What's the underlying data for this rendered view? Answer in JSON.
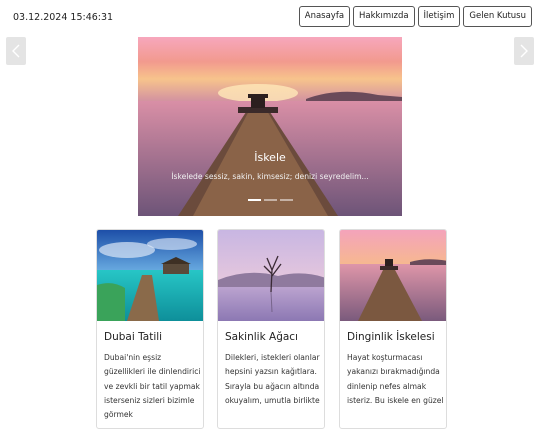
{
  "header": {
    "datetime": "03.12.2024 15:46:31"
  },
  "nav": {
    "items": [
      "Anasayfa",
      "Hakkımızda",
      "İletişim",
      "Gelen Kutusu"
    ]
  },
  "carousel": {
    "prev_icon": "chevron-left-icon",
    "next_icon": "chevron-right-icon",
    "slide_title": "İskele",
    "slide_text": "İskelede sessiz, sakin, kimsesiz; denizi seyredelim...",
    "indicator_count": 3,
    "active_indicator": 1
  },
  "cards": [
    {
      "title": "Dubai Tatili",
      "text": "Dubai'nin eşsiz güzellikleri ile dinlendirici ve zevkli bir tatil yapmak isterseniz sizleri bizimle görmek"
    },
    {
      "title": "Sakinlik Ağacı",
      "text": "Dilekleri, istekleri olanlar hepsini yazsın kağıtlara. Sırayla bu ağacın altında okuyalım, umutla birlikte"
    },
    {
      "title": "Dinginlik İskelesi",
      "text": "Hayat koşturmacası yakanızı bırakmadığında dinlenip nefes almak isteriz. Bu iskele en güzel"
    }
  ]
}
